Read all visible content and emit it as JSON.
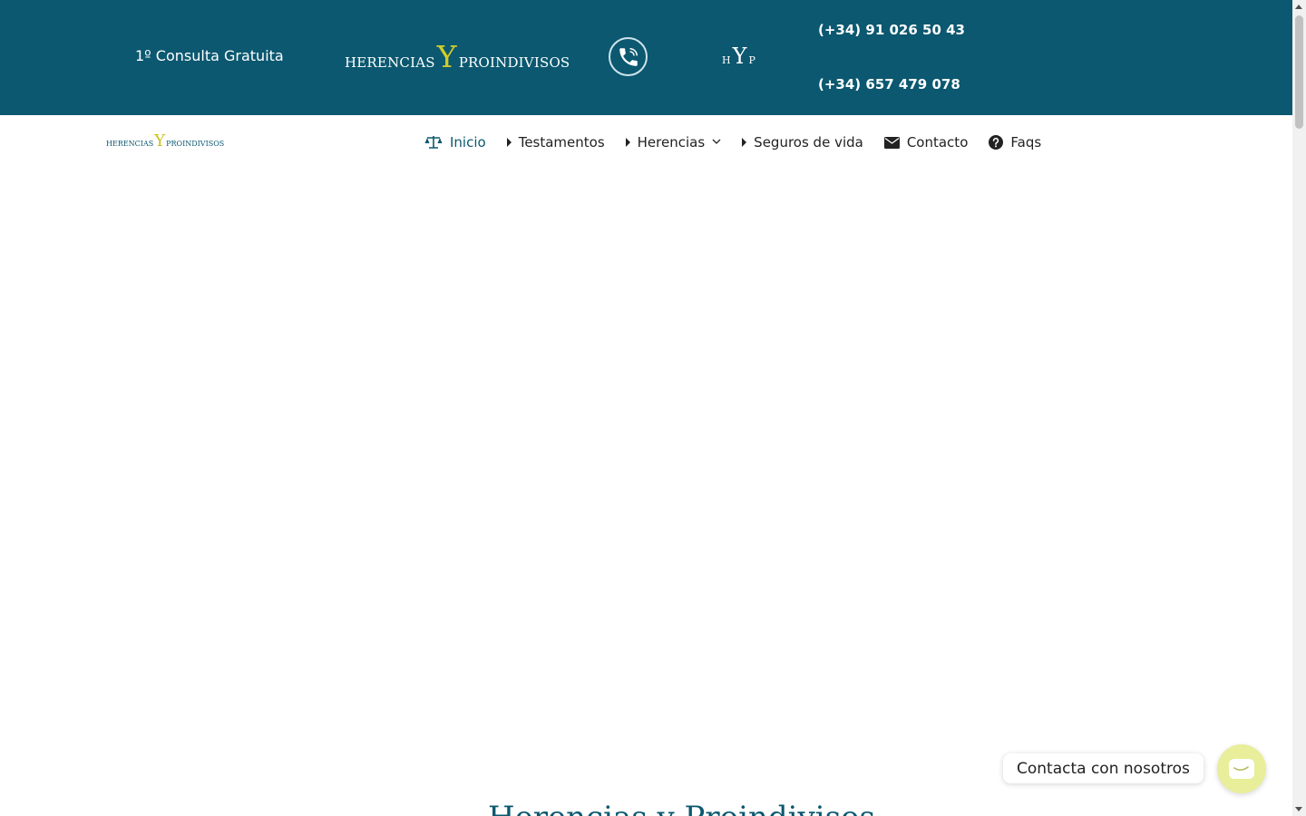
{
  "topbar": {
    "consulta": "1º Consulta Gratuita",
    "brand": {
      "left": "HERENCIAS",
      "mid": "Y",
      "right": "PROINDIVISOS"
    },
    "monogram": {
      "h": "H",
      "y": "Y",
      "p": "P"
    },
    "phones": [
      "(+34) 91 026 50 43",
      "(+34) 657 479 078"
    ],
    "phone_icon": "phone-call-icon"
  },
  "navbar": {
    "logo": {
      "left": "HERENCIAS",
      "mid": "Y",
      "right": "PROINDIVISOS"
    },
    "menu": [
      {
        "label": "Inicio",
        "icon": "scale-icon",
        "active": true
      },
      {
        "label": "Testamentos",
        "icon": "caret-right-icon"
      },
      {
        "label": "Herencias",
        "icon": "caret-right-icon",
        "has_dropdown": true
      },
      {
        "label": "Seguros de vida",
        "icon": "caret-right-icon"
      },
      {
        "label": "Contacto",
        "icon": "envelope-icon"
      },
      {
        "label": "Faqs",
        "icon": "question-circle-icon"
      }
    ]
  },
  "main": {
    "heading": "Herencias y Proindivisos"
  },
  "chat": {
    "label": "Contacta con nosotros",
    "icon": "chat-icon"
  },
  "colors": {
    "primary": "#0b5870",
    "accent": "#d1cc2a",
    "chat_bg": "#e8ee9a"
  }
}
